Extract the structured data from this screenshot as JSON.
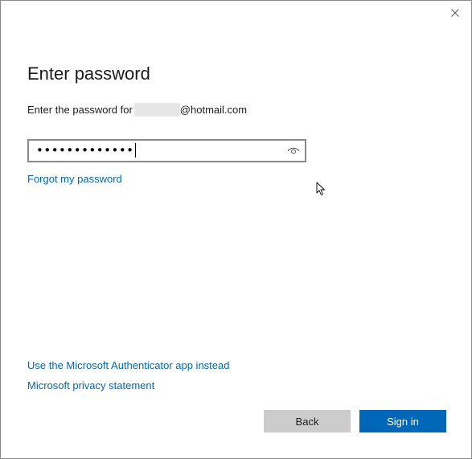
{
  "dialog": {
    "title": "Enter password",
    "prompt_prefix": "Enter the password for",
    "prompt_suffix": "@hotmail.com",
    "password": {
      "masked_value": "•••••••••••••",
      "reveal_icon": "eye-icon"
    },
    "forgot_link": "Forgot my password",
    "authenticator_link": "Use the Microsoft Authenticator app instead",
    "privacy_link": "Microsoft privacy statement",
    "back_label": "Back",
    "signin_label": "Sign in",
    "close_icon": "close-icon"
  },
  "colors": {
    "accent": "#0067b8",
    "secondary_button": "#cccccc",
    "border": "#8a8a8a"
  }
}
